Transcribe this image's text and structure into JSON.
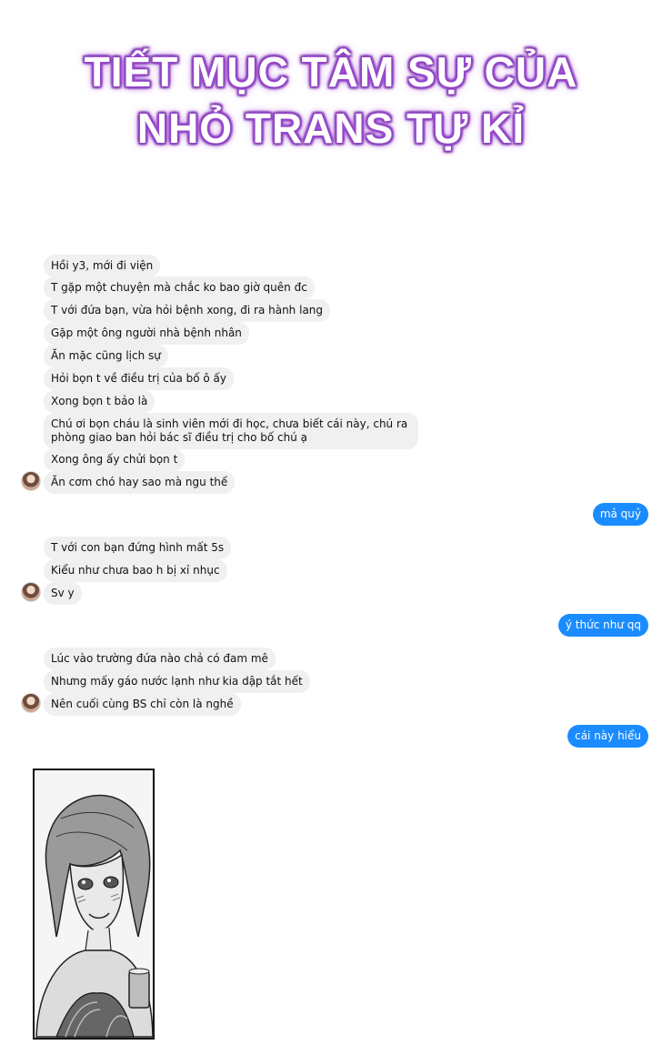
{
  "title": {
    "line1": "TIẾT MỤC TÂM SỰ CỦA",
    "line2": "NHỎ TRANS TỰ KỈ"
  },
  "messages": {
    "m1": "Hồi y3, mới đi viện",
    "m2": "T gặp một chuyện mà chắc ko bao giờ quên đc",
    "m3": "T với đứa bạn, vừa hỏi bệnh xong, đi ra hành lang",
    "m4": "Gặp một ông người nhà bệnh nhân",
    "m5": "Ăn mặc cũng lịch sự",
    "m6": "Hỏi bọn t về điều trị của bố ô ấy",
    "m7": "Xong bọn t bảo là",
    "m8": "Chú ơi bọn cháu là sinh viên mới đi học, chưa biết cái này, chú ra phòng giao ban hỏi bác sĩ điều trị cho bố chú ạ",
    "m9": "Xong ông ấy chửi bọn t",
    "m10": "Ăn cơm chó hay sao mà ngu thế",
    "r1": "mả quỷ",
    "m11": "T với con bạn đứng hình mất 5s",
    "m12": "Kiểu như chưa bao h bị xỉ nhục",
    "m13": "Sv y",
    "r2": "ý thức như qq",
    "m14": "Lúc vào trường đứa nào chả có đam mê",
    "m15": "Nhưng mấy gáo nước lạnh như kia dập tắt hết",
    "m16": "Nên cuối cùng BS chỉ còn là nghề",
    "r3": "cái này hiểu"
  },
  "colors": {
    "incoming": "#f0f0f0",
    "outgoing": "#1a8cff",
    "title_glow": "#a24fd6"
  }
}
